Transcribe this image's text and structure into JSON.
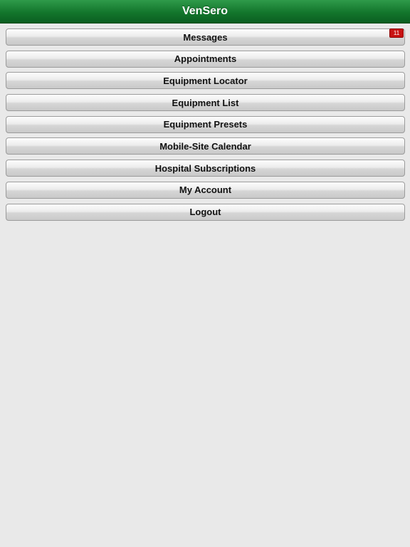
{
  "app": {
    "title": "VenSero"
  },
  "menu": {
    "items": [
      {
        "label": "Messages",
        "badge": "11"
      },
      {
        "label": "Appointments"
      },
      {
        "label": "Equipment Locator"
      },
      {
        "label": "Equipment List"
      },
      {
        "label": "Equipment Presets"
      },
      {
        "label": "Mobile-Site Calendar"
      },
      {
        "label": "Hospital Subscriptions"
      },
      {
        "label": "My Account"
      },
      {
        "label": "Logout"
      }
    ]
  },
  "colors": {
    "header_green": "#13762c",
    "badge_red": "#c81212",
    "background": "#e9e9e9"
  }
}
